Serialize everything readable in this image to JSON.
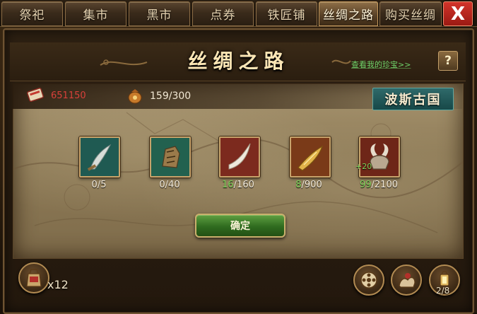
{
  "tabs": [
    {
      "label": "祭祀"
    },
    {
      "label": "集市"
    },
    {
      "label": "黑市"
    },
    {
      "label": "点券"
    },
    {
      "label": "铁匠铺"
    },
    {
      "label": "丝绸之路"
    },
    {
      "label": "购买丝绸"
    }
  ],
  "active_tab": "丝绸之路",
  "close_label": "X",
  "title": "丝绸之路",
  "treasure_link": "查看我的珍宝>>",
  "help_label": "?",
  "currencies": [
    {
      "icon": "silk-scroll-icon",
      "value": "651150"
    },
    {
      "icon": "coin-pouch-icon",
      "value": "159/300"
    }
  ],
  "region": "波斯古国",
  "items": [
    {
      "icon": "curved-dagger-icon",
      "have": "0",
      "need": "/5"
    },
    {
      "icon": "gauntlet-relic-icon",
      "have": "0",
      "need": "/40"
    },
    {
      "icon": "ivory-tusk-icon",
      "have": "16",
      "need": "/160"
    },
    {
      "icon": "golden-blade-icon",
      "have": "8",
      "need": "/900"
    },
    {
      "icon": "horned-helm-icon",
      "have": "99",
      "need": "/2100"
    }
  ],
  "bonus_label": "+20",
  "confirm_label": "确定",
  "bag": {
    "icon": "silk-bag-icon",
    "count": "x12"
  },
  "bottom_buttons": [
    {
      "icon": "film-reel-icon"
    },
    {
      "icon": "camel-rider-icon"
    },
    {
      "icon": "lantern-icon"
    }
  ],
  "slot_counter": "2/8",
  "colors": {
    "accent_gold": "#c7a36b",
    "have_green": "#7fd45a",
    "link_green": "#6fd36a",
    "close_red": "#c3271d",
    "region_teal": "#2f6a6a"
  }
}
